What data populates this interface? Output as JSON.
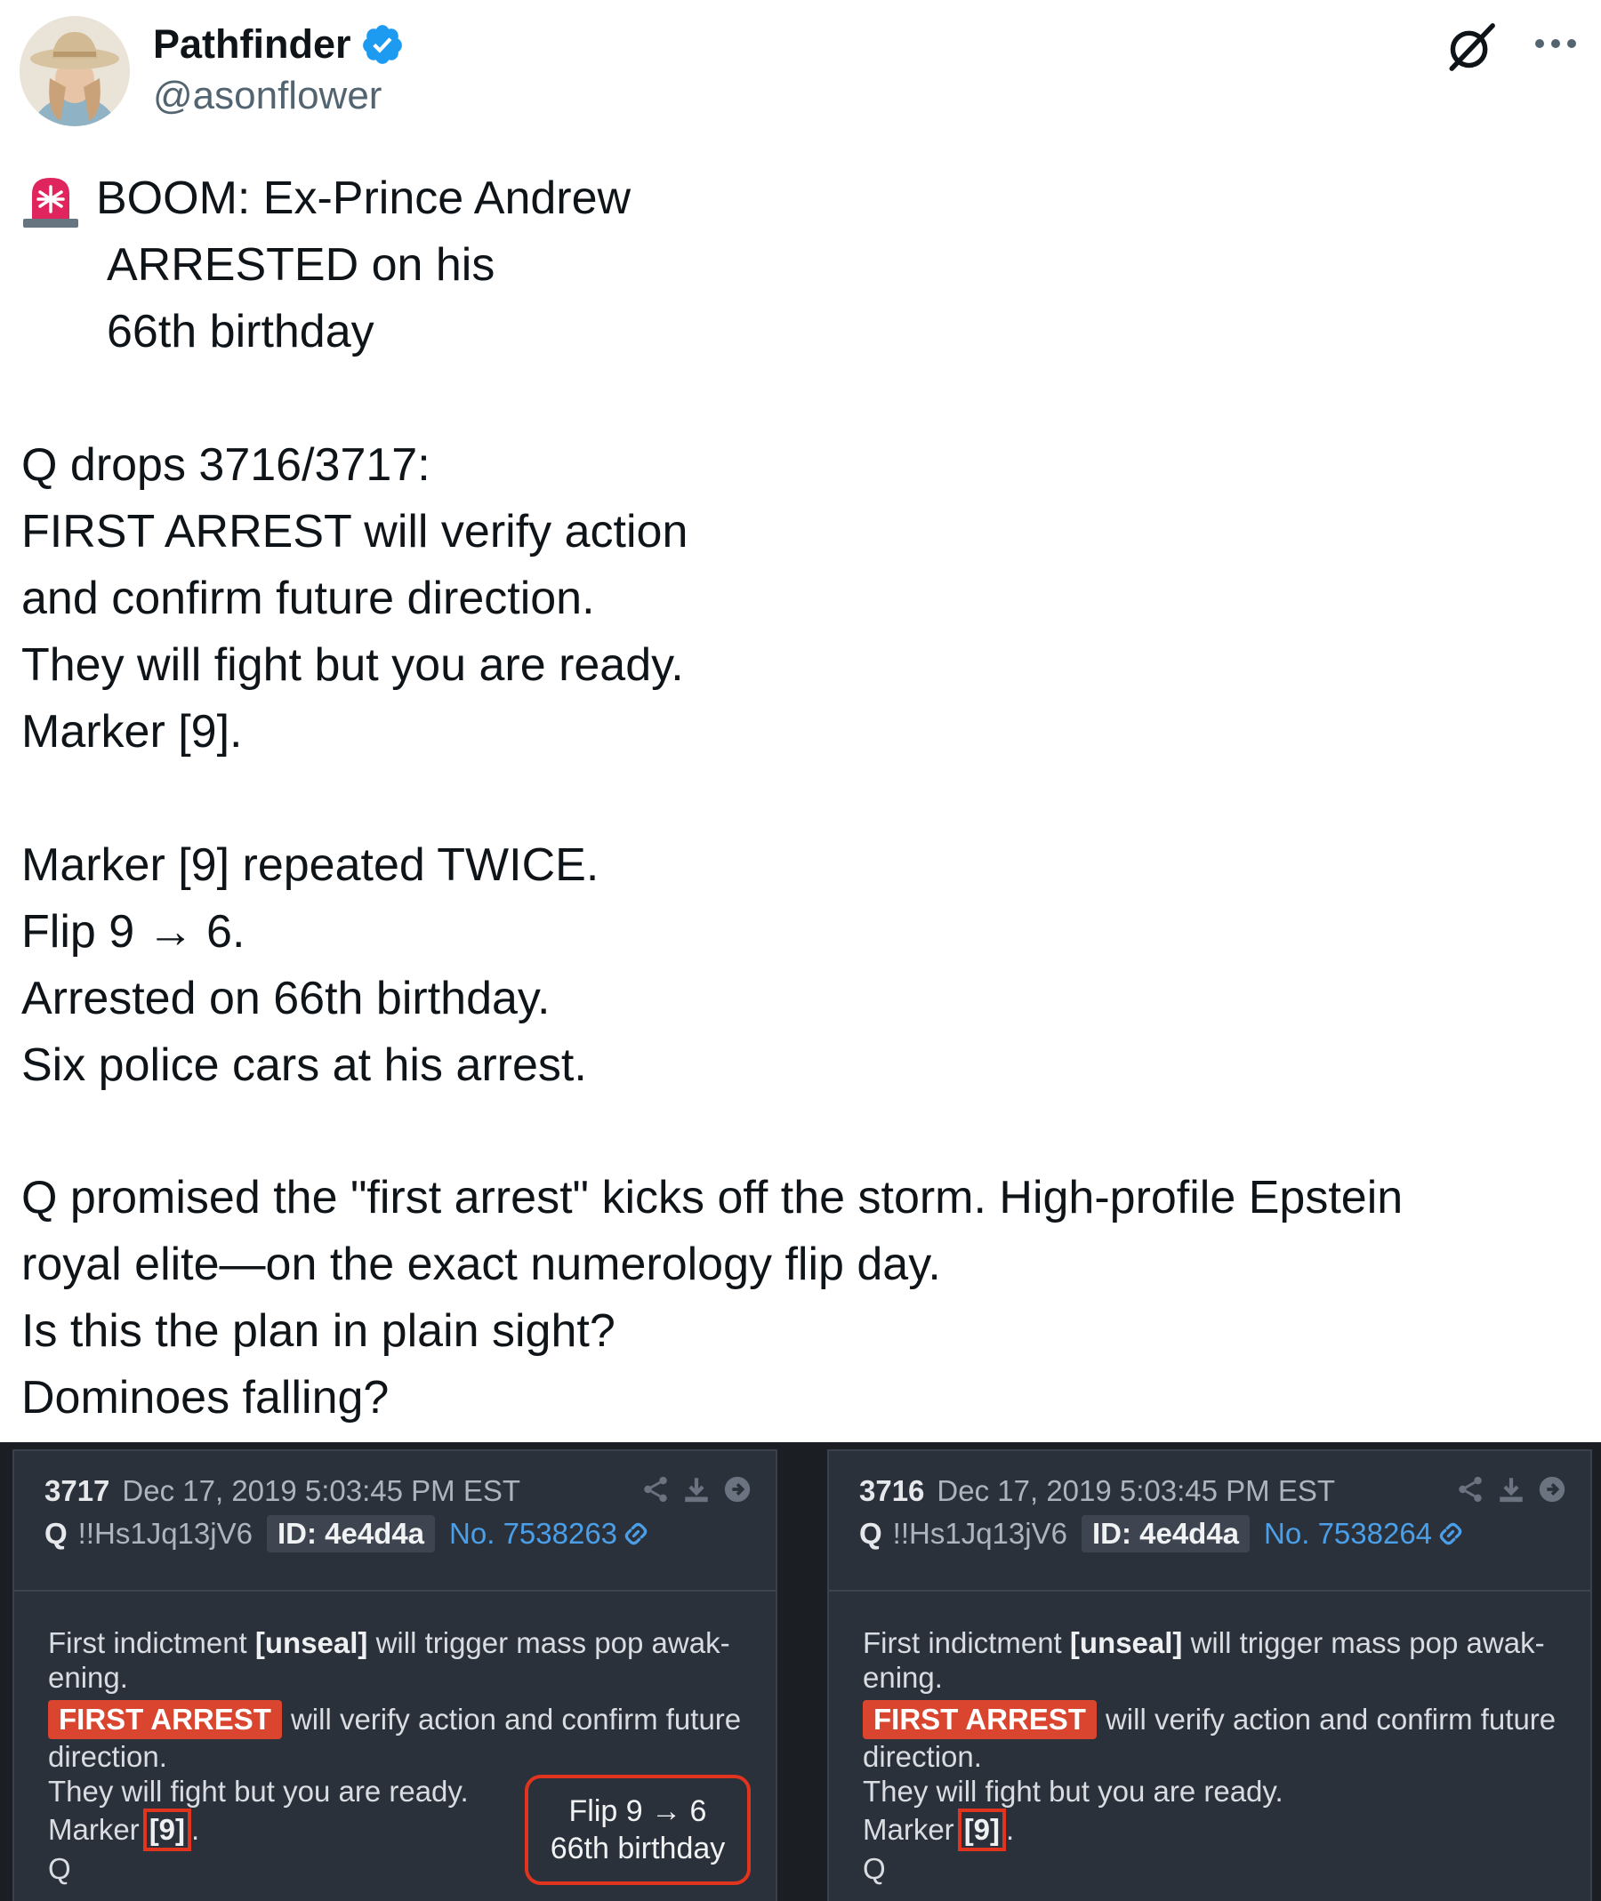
{
  "author": {
    "name": "Pathfinder",
    "handle": "@asonflower",
    "verified_color": "#1d9bf0"
  },
  "icons": [
    "grok-icon",
    "more-icon",
    "siren-icon",
    "verified-badge-icon",
    "share-icon",
    "download-icon",
    "arrow-right-icon",
    "link-icon"
  ],
  "tweet": {
    "headline": [
      "BOOM: Ex-Prince Andrew",
      "ARRESTED on his",
      "66th birthday"
    ],
    "para1": [
      "Q drops 3716/3717:",
      "FIRST ARREST will verify action",
      "and confirm future direction.",
      "They will fight but you are ready.",
      "Marker [9]."
    ],
    "para2": [
      "Marker [9] repeated TWICE.",
      "Flip 9 → 6.",
      "Arrested on 66th birthday.",
      "Six police cars at his arrest."
    ],
    "para3": [
      "Q promised the \"first arrest\" kicks off the storm. High-profile Epstein",
      "royal elite—on the exact numerology flip day.",
      "Is this the plan in plain sight?",
      "Dominoes falling?"
    ]
  },
  "posts": [
    {
      "number": "3717",
      "date": "Dec 17, 2019 5:03:45 PM EST",
      "author": "Q",
      "trip": "!!Hs1Jq13jV6",
      "id": "ID: 4e4d4a",
      "post_no": "No. 7538263",
      "body": {
        "l1a": "First indictment ",
        "l1b": "[unseal]",
        "l1c": " will trigger mass pop awak-",
        "l2": "ening.",
        "arrest": "FIRST ARREST",
        "l3": "will verify action and confirm future",
        "l4": "direction.",
        "l5": "They will fight but you are ready.",
        "marker_pre": "Marker",
        "marker": "[9]",
        "marker_post": ".",
        "sign": "Q"
      },
      "callout": [
        "Flip 9 → 6",
        "66th birthday"
      ]
    },
    {
      "number": "3716",
      "date": "Dec 17, 2019 5:03:45 PM EST",
      "author": "Q",
      "trip": "!!Hs1Jq13jV6",
      "id": "ID: 4e4d4a",
      "post_no": "No. 7538264",
      "body": {
        "l1a": "First indictment ",
        "l1b": "[unseal]",
        "l1c": " will trigger mass pop awak-",
        "l2": "ening.",
        "arrest": "FIRST ARREST",
        "l3": "will verify action and confirm future",
        "l4": "direction.",
        "l5": "They will fight but you are ready.",
        "marker_pre": "Marker",
        "marker": "[9]",
        "marker_post": ".",
        "sign": "Q"
      }
    }
  ]
}
